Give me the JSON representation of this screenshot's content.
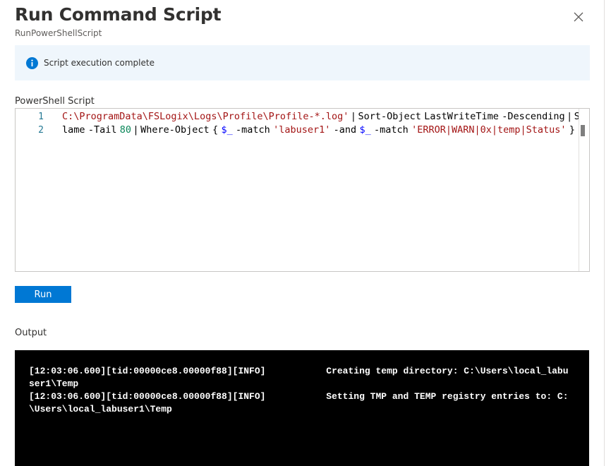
{
  "dialog": {
    "title": "Run Command Script",
    "subtitle": "RunPowerShellScript",
    "close_icon": "close-icon"
  },
  "info_bar": {
    "icon": "info-icon",
    "message": "Script execution complete",
    "accent_color": "#0078d4"
  },
  "script_section": {
    "label": "PowerShell Script",
    "lines": [
      {
        "number": "1",
        "tokens": [
          {
            "type": "str",
            "text": "C:\\ProgramData\\FSLogix\\Logs\\Profile\\Profile-*.log'"
          },
          {
            "type": "op",
            "text": " | "
          },
          {
            "type": "plain",
            "text": "Sort-Object"
          },
          {
            "type": "op",
            "text": " "
          },
          {
            "type": "plain",
            "text": "LastWriteTime"
          },
          {
            "type": "op",
            "text": " "
          },
          {
            "type": "plain",
            "text": "-Descending"
          },
          {
            "type": "op",
            "text": " | "
          },
          {
            "type": "plain",
            "text": "Se"
          }
        ]
      },
      {
        "number": "2",
        "tokens": [
          {
            "type": "plain",
            "text": "lame"
          },
          {
            "type": "op",
            "text": " "
          },
          {
            "type": "plain",
            "text": "-Tail"
          },
          {
            "type": "op",
            "text": " "
          },
          {
            "type": "num",
            "text": "80"
          },
          {
            "type": "op",
            "text": " | "
          },
          {
            "type": "plain",
            "text": "Where-Object"
          },
          {
            "type": "op",
            "text": " "
          },
          {
            "type": "plain",
            "text": "{"
          },
          {
            "type": "op",
            "text": " "
          },
          {
            "type": "var",
            "text": "$_"
          },
          {
            "type": "op",
            "text": " "
          },
          {
            "type": "plain",
            "text": "-match"
          },
          {
            "type": "op",
            "text": " "
          },
          {
            "type": "str",
            "text": "'labuser1'"
          },
          {
            "type": "op",
            "text": " "
          },
          {
            "type": "plain",
            "text": "-and"
          },
          {
            "type": "op",
            "text": " "
          },
          {
            "type": "var",
            "text": "$_"
          },
          {
            "type": "op",
            "text": " "
          },
          {
            "type": "plain",
            "text": "-match"
          },
          {
            "type": "op",
            "text": " "
          },
          {
            "type": "str",
            "text": "'ERROR|WARN|0x|temp|Status'"
          },
          {
            "type": "op",
            "text": " "
          },
          {
            "type": "plain",
            "text": "}"
          }
        ]
      }
    ]
  },
  "run_button": {
    "label": "Run",
    "color": "#0078d4"
  },
  "output_section": {
    "label": "Output",
    "lines": [
      "[12:03:06.600][tid:00000ce8.00000f88][INFO]           Creating temp directory: C:\\Users\\local_labu",
      "ser1\\Temp",
      "[12:03:06.600][tid:00000ce8.00000f88][INFO]           Setting TMP and TEMP registry entries to: C:",
      "\\Users\\local_labuser1\\Temp"
    ]
  }
}
